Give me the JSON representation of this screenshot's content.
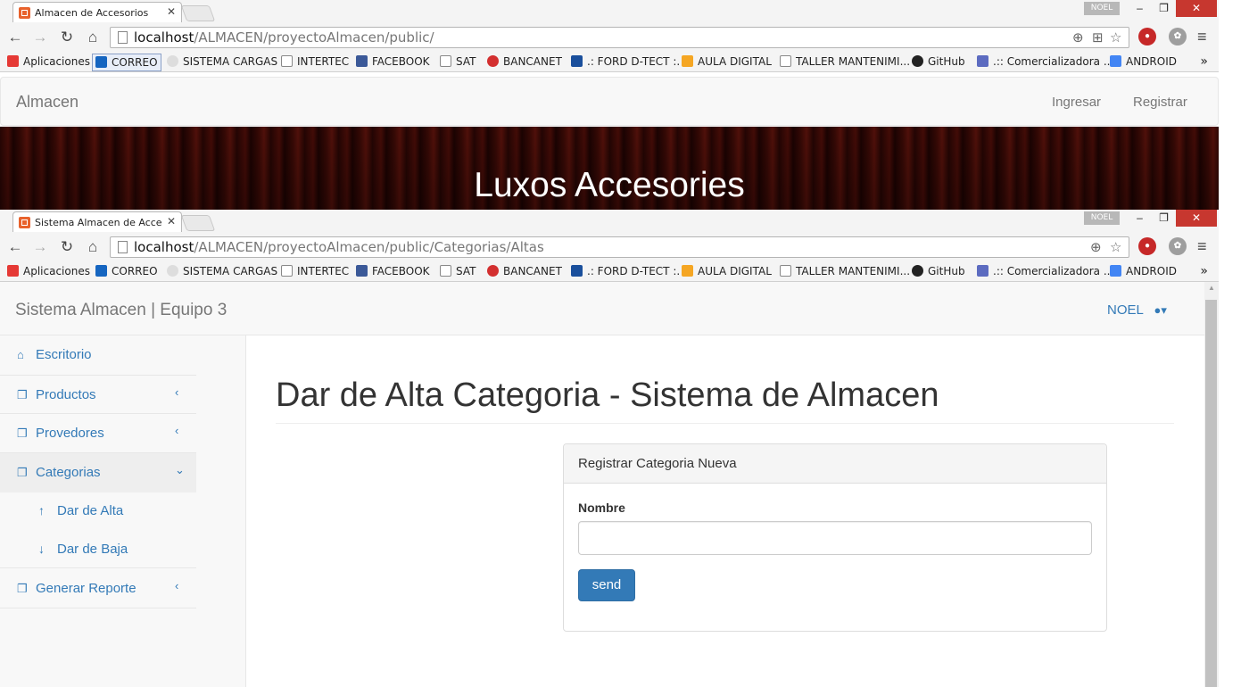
{
  "window1": {
    "tab_title": "Almacen de Accesorios",
    "user_badge": "NOEL",
    "url_host": "localhost",
    "url_path": "/ALMACEN/proyectoAlmacen/public/"
  },
  "window2": {
    "tab_title": "Sistema Almacen de Acce",
    "user_badge": "NOEL",
    "url_host": "localhost",
    "url_path": "/ALMACEN/proyectoAlmacen/public/Categorias/Altas"
  },
  "bookmarks": [
    "Aplicaciones",
    "CORREO",
    "SISTEMA CARGAS",
    "INTERTEC",
    "FACEBOOK",
    "SAT",
    "BANCANET",
    ".: FORD D-TECT :.",
    "AULA DIGITAL",
    "TALLER MANTENIMI...",
    "GitHub",
    ".:: Comercializadora ...",
    "ANDROID"
  ],
  "bookmarks_more": "»",
  "page1": {
    "brand": "Almacen",
    "nav_login": "Ingresar",
    "nav_register": "Registrar",
    "hero_title": "Luxos Accesories"
  },
  "page2": {
    "brand": "Sistema Almacen | Equipo 3",
    "user_menu": "NOEL",
    "sidebar": {
      "dashboard": "Escritorio",
      "products": "Productos",
      "providers": "Provedores",
      "categories": "Categorias",
      "sub_add": "Dar de Alta",
      "sub_remove": "Dar de Baja",
      "report": "Generar Reporte"
    },
    "page_title": "Dar de Alta Categoria - Sistema de Almacen",
    "panel": {
      "heading": "Registrar Categoria Nueva",
      "field_label": "Nombre",
      "field_value": "",
      "submit_label": "send"
    }
  },
  "colors": {
    "link": "#337ab7",
    "primary_button": "#337ab7",
    "window_close": "#c7372f",
    "hero_wood": "#3c0a06"
  },
  "icons": [
    "favicon-icon",
    "tab-close-icon",
    "back-icon",
    "forward-icon",
    "reload-icon",
    "home-icon",
    "page-icon",
    "zoom-icon",
    "translate-icon",
    "star-icon",
    "adblock-icon",
    "extension-icon",
    "chrome-menu-icon",
    "apps-grid-icon",
    "home-icon",
    "copy-icon",
    "chevron-left-icon",
    "chevron-down-icon",
    "arrow-up-icon",
    "arrow-down-icon",
    "user-icon",
    "caret-down-icon"
  ]
}
